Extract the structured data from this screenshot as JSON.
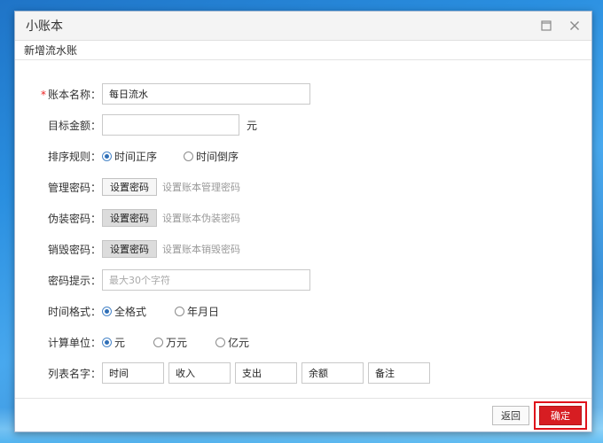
{
  "window": {
    "title": "小账本"
  },
  "section": {
    "title": "新增流水账"
  },
  "form": {
    "account_name": {
      "label": "账本名称：",
      "value": "每日流水",
      "required_mark": "*"
    },
    "target_amount": {
      "label": "目标金额：",
      "value": "",
      "unit": "元"
    },
    "sort_rule": {
      "label": "排序规则：",
      "options": [
        "时间正序",
        "时间倒序"
      ],
      "selected": "时间正序"
    },
    "manage_password": {
      "label": "管理密码：",
      "button": "设置密码",
      "hint": "设置账本管理密码"
    },
    "fake_password": {
      "label": "伪装密码：",
      "button": "设置密码",
      "hint": "设置账本伪装密码"
    },
    "destroy_password": {
      "label": "销毁密码：",
      "button": "设置密码",
      "hint": "设置账本销毁密码"
    },
    "password_hint": {
      "label": "密码提示：",
      "placeholder": "最大30个字符"
    },
    "time_format": {
      "label": "时间格式：",
      "options": [
        "全格式",
        "年月日"
      ],
      "selected": "全格式"
    },
    "calc_unit": {
      "label": "计算单位：",
      "options": [
        "元",
        "万元",
        "亿元"
      ],
      "selected": "元"
    },
    "column_names": {
      "label": "列表名字：",
      "values": [
        "时间",
        "收入",
        "支出",
        "余额",
        "备注"
      ]
    }
  },
  "footer": {
    "back_label": "返回",
    "ok_label": "确定"
  },
  "colors": {
    "accent": "#d71d22",
    "highlight_frame": "#e0121b",
    "radio": "#2f6fb7"
  }
}
